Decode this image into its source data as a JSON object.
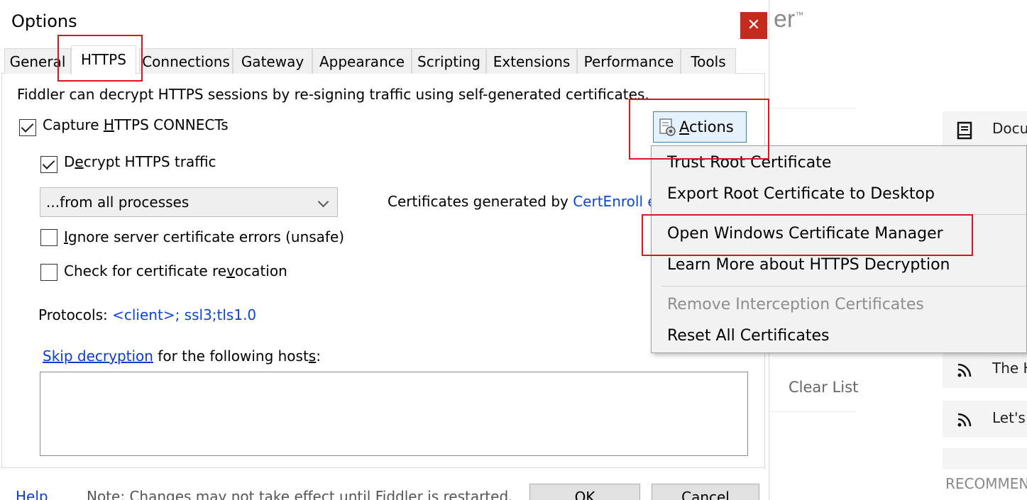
{
  "background": {
    "brand_fragment": "er",
    "brand_mark": "™",
    "clear_list_label": "Clear List",
    "cards": [
      {
        "icon": "book-icon",
        "text": "Docu"
      },
      {
        "icon": "rss-feed-icon",
        "text": "The H"
      },
      {
        "icon": "rss-feed-icon",
        "text": "Let's"
      }
    ],
    "recommend_label": "RECOMMEN"
  },
  "dialog": {
    "title": "Options",
    "close_glyph": "✕",
    "tabs": [
      "General",
      "HTTPS",
      "Connections",
      "Gateway",
      "Appearance",
      "Scripting",
      "Extensions",
      "Performance",
      "Tools"
    ],
    "active_tab": "HTTPS",
    "https": {
      "intro": "Fiddler can decrypt HTTPS sessions by re-signing traffic using self-generated certificates.",
      "capture_connects": {
        "pre": "Capture ",
        "u": "H",
        "post": "TTPS CONNECTs",
        "checked": true
      },
      "decrypt_traffic": {
        "pre": "D",
        "u": "e",
        "post": "crypt HTTPS traffic",
        "checked": true
      },
      "process_filter": "...from all processes",
      "ignore_errors": {
        "pre": "",
        "u": "I",
        "post": "gnore server certificate errors (unsafe)",
        "checked": false
      },
      "check_revocation": {
        "pre": "Check for certificate re",
        "u": "v",
        "post": "ocation",
        "checked": false
      },
      "cert_generated_prefix": "Certificates generated by ",
      "cert_engine": "CertEnroll e",
      "protocols_label": "Protocols: ",
      "protocols_value": "<client>; ssl3;tls1.0",
      "skip_link": "Skip decryption",
      "skip_rest_pre": " for the following host",
      "skip_rest_u": "s",
      "skip_rest_post": ":",
      "skip_hosts_value": ""
    },
    "actions": {
      "label_u": "A",
      "label_rest": "ctions",
      "menu": [
        {
          "label": "Trust Root Certificate",
          "enabled": true
        },
        {
          "label": "Export Root Certificate to Desktop",
          "enabled": true
        },
        {
          "label": "Open Windows Certificate Manager",
          "enabled": true
        },
        {
          "label": "Learn More about HTTPS Decryption",
          "enabled": true
        },
        {
          "label": "Remove Interception Certificates",
          "enabled": false
        },
        {
          "label": "Reset All Certificates",
          "enabled": true
        }
      ]
    },
    "footer": {
      "help": "Help",
      "note": "Note: Changes may not take effect until Fiddler is restarted.",
      "ok": "OK",
      "cancel": "Cancel"
    }
  },
  "colors": {
    "highlight": "#e0141e",
    "link": "#0b46d6",
    "close": "#c42b1c"
  }
}
